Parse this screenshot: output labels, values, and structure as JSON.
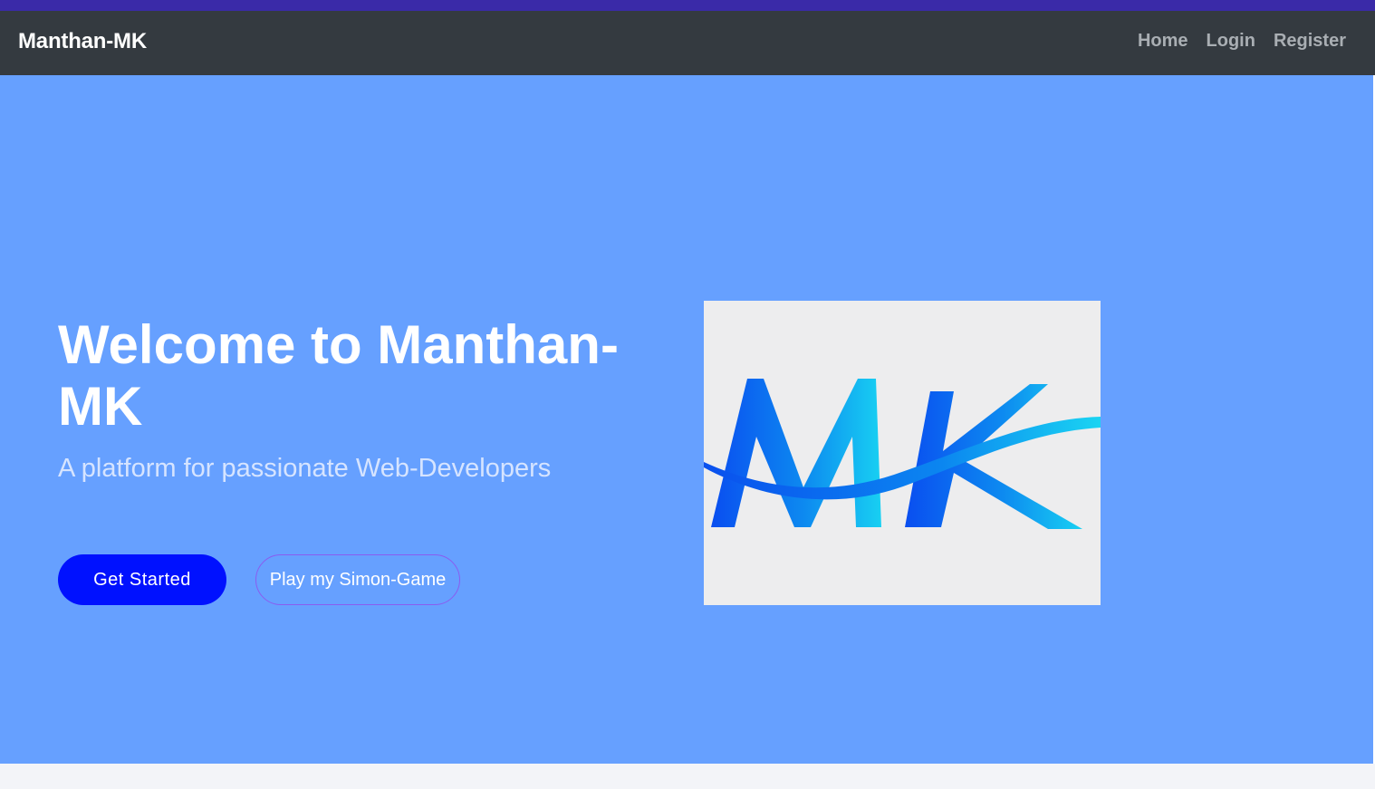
{
  "navbar": {
    "brand": "Manthan-MK",
    "links": [
      {
        "label": "Home"
      },
      {
        "label": "Login"
      },
      {
        "label": "Register"
      }
    ]
  },
  "hero": {
    "title": "Welcome to Manthan-MK",
    "subtitle": "A platform for passionate Web-Developers",
    "primary_button": "Get Started",
    "secondary_button": "Play my Simon-Game",
    "logo_text": "MK"
  },
  "colors": {
    "top_strip": "#3a2aa8",
    "navbar_bg": "#343a40",
    "hero_bg": "#66a0ff",
    "primary_button_bg": "#0011ff",
    "secondary_button_border": "#8a5cf0",
    "logo_blue_dark": "#0a5cf0",
    "logo_blue_light": "#18c8f0"
  },
  "icons": {
    "logo": "mk-wave-logo"
  }
}
